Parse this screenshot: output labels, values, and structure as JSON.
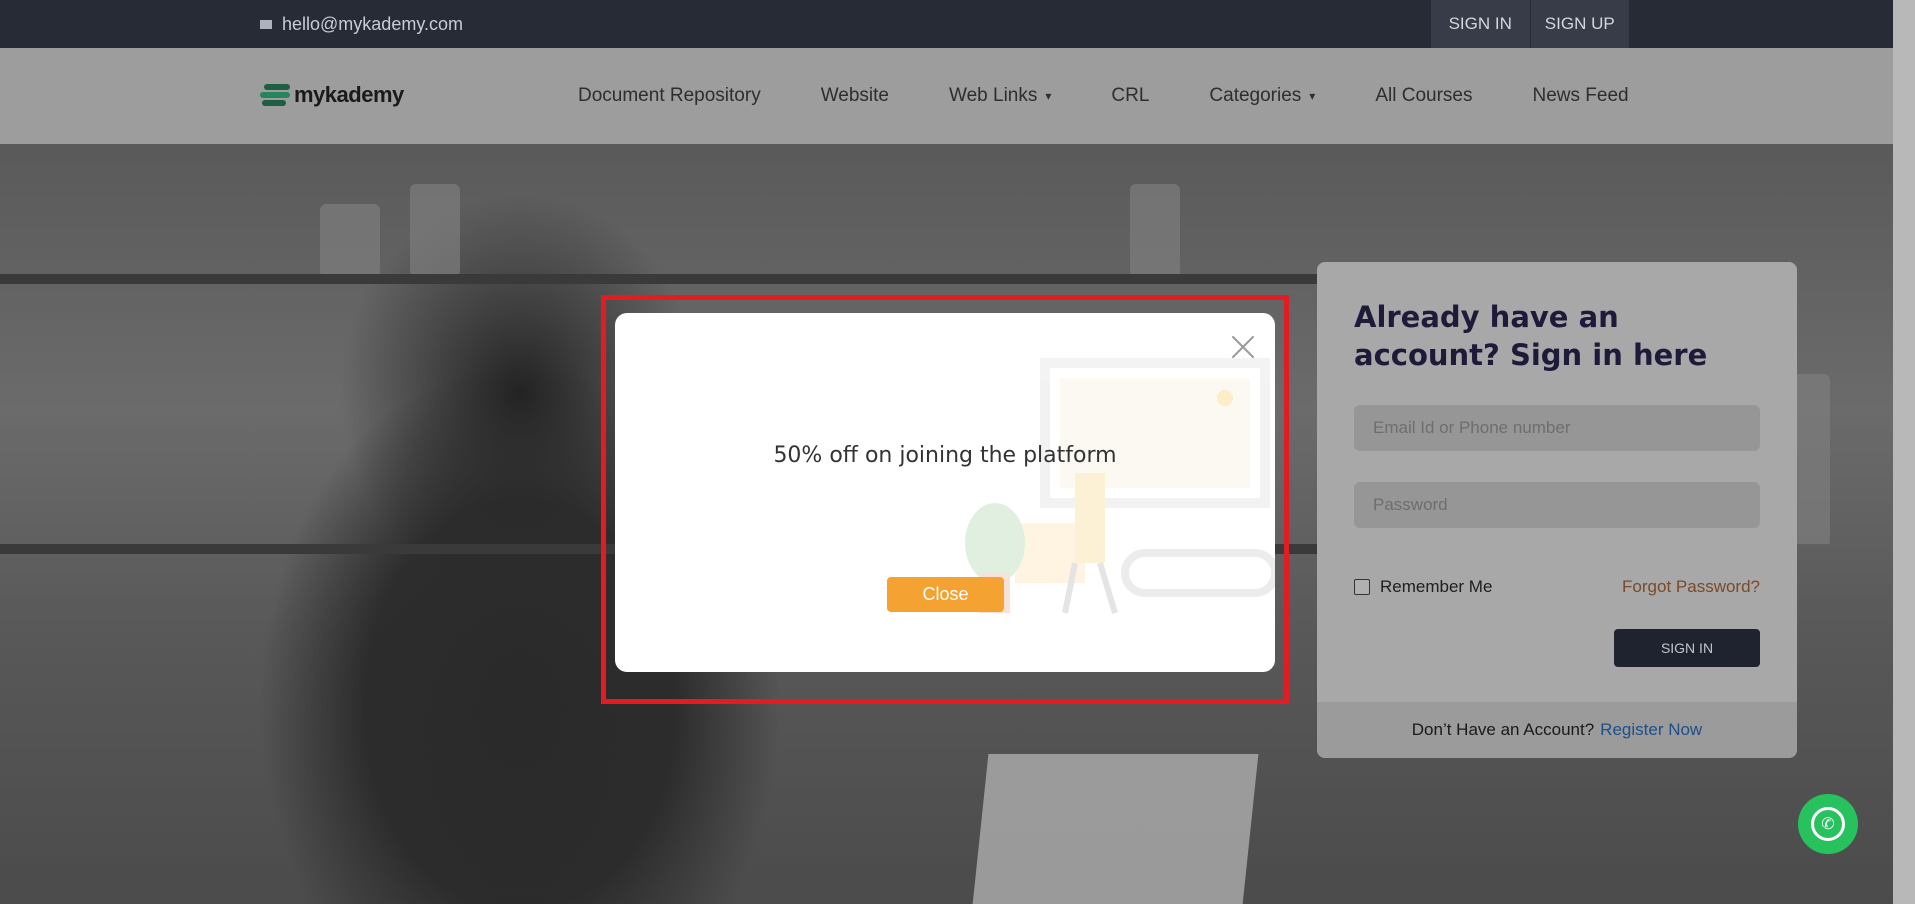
{
  "topbar": {
    "email": "hello@mykademy.com",
    "email_icon": "envelope-icon",
    "sign_in": "SIGN IN",
    "sign_up": "SIGN UP"
  },
  "nav": {
    "logo_text": "mykademy",
    "items": [
      {
        "label": "Document Repository",
        "dropdown": false
      },
      {
        "label": "Website",
        "dropdown": false
      },
      {
        "label": "Web Links",
        "dropdown": true
      },
      {
        "label": "CRL",
        "dropdown": false
      },
      {
        "label": "Categories",
        "dropdown": true
      },
      {
        "label": "All Courses",
        "dropdown": false
      },
      {
        "label": "News Feed",
        "dropdown": false
      }
    ],
    "chevron": "⌄"
  },
  "login": {
    "heading": "Already have an account? Sign in here",
    "email_placeholder": "Email Id or Phone number",
    "password_placeholder": "Password",
    "remember_label": "Remember Me",
    "forgot_label": "Forgot Password?",
    "signin_button": "SIGN IN",
    "no_account_text": "Don’t Have an Account?",
    "register_link": "Register Now"
  },
  "modal": {
    "message": "50% off on joining the platform",
    "close_button": "Close",
    "close_icon": "close-icon"
  },
  "colors": {
    "topbar_bg": "#272b36",
    "accent_orange": "#f4a231",
    "highlight_red": "#e31b23",
    "whatsapp_green": "#27c15e"
  }
}
